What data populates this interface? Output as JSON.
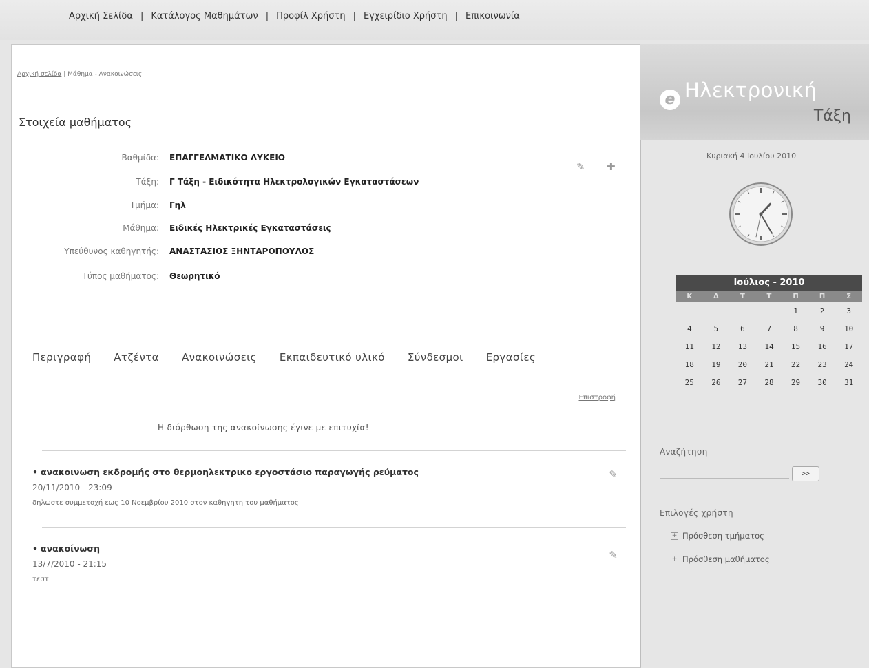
{
  "nav": {
    "items": [
      "Αρχική Σελίδα",
      "Κατάλογος Μαθημάτων",
      "Προφίλ Χρήστη",
      "Εγχειρίδιο Χρήστη",
      "Επικοινωνία"
    ],
    "separator": "|"
  },
  "breadcrumb": {
    "home": "Αρχική σελίδα",
    "sep": " | ",
    "current": "Μάθημα - Ανακοινώσεις"
  },
  "course": {
    "title": "Στοιχεία μαθήματος",
    "fields": [
      {
        "label": "Βαθμίδα:",
        "value": "ΕΠΑΓΓΕΛΜΑΤΙΚΟ ΛΥΚΕΙΟ"
      },
      {
        "label": "Τάξη:",
        "value": "Γ Τάξη - Ειδικότητα Ηλεκτρολογικών Εγκαταστάσεων"
      },
      {
        "label": "Τμήμα:",
        "value": "Γηλ"
      },
      {
        "label": "Μάθημα:",
        "value": "Ειδικές Ηλεκτρικές Εγκαταστάσεις"
      },
      {
        "label": "Υπεύθυνος καθηγητής:",
        "value": "ΑΝΑΣΤΑΣΙΟΣ ΞΗΝΤΑΡΟΠΟΥΛΟΣ"
      },
      {
        "label": "Τύπος μαθήματος:",
        "value": "Θεωρητικό"
      }
    ],
    "edit_icon": "✎",
    "add_icon": "✚"
  },
  "tabs": [
    "Περιγραφή",
    "Ατζέντα",
    "Ανακοινώσεις",
    "Εκπαιδευτικό υλικό",
    "Σύνδεσμοι",
    "Εργασίες"
  ],
  "back_link": "Επιστροφή",
  "success_message": "Η διόρθωση της ανακοίνωσης έγινε με επιτυχία!",
  "announcements": [
    {
      "title": "ανακοινωση εκδρομής στο θερμοηλεκτρικο εργοστάσιο παραγωγής ρεύματος",
      "date": "20/11/2010 - 23:09",
      "body": "δηλωστε συμμετοχή εως 10 Νοεμβρίου 2010 στον καθηγητη του μαθήματος"
    },
    {
      "title": "ανακοίνωση",
      "date": "13/7/2010 - 21:15",
      "body": "τεστ"
    }
  ],
  "announcement_bullet": "•",
  "sidebar": {
    "logo_mark": "e",
    "logo_line1": "Ηλεκτρονική",
    "logo_line2": "Τάξη",
    "date_text": "Κυριακή 4 Ιουλίου 2010",
    "clock": {
      "hour": 1,
      "minute": 25,
      "second": 32
    },
    "calendar": {
      "title": "Ιούλιος - 2010",
      "weekdays": [
        "Κ",
        "Δ",
        "Τ",
        "Τ",
        "Π",
        "Π",
        "Σ"
      ],
      "weeks": [
        [
          "",
          "",
          "",
          "",
          "1",
          "2",
          "3"
        ],
        [
          "4",
          "5",
          "6",
          "7",
          "8",
          "9",
          "10"
        ],
        [
          "11",
          "12",
          "13",
          "14",
          "15",
          "16",
          "17"
        ],
        [
          "18",
          "19",
          "20",
          "21",
          "22",
          "23",
          "24"
        ],
        [
          "25",
          "26",
          "27",
          "28",
          "29",
          "30",
          "31"
        ]
      ]
    },
    "search_label": "Αναζήτηση",
    "search_button": ">>",
    "options_label": "Επιλογές χρήστη",
    "option_items": [
      "Πρόσθεση τμήματος",
      "Πρόσθεση μαθήματος"
    ],
    "option_box": "+"
  }
}
